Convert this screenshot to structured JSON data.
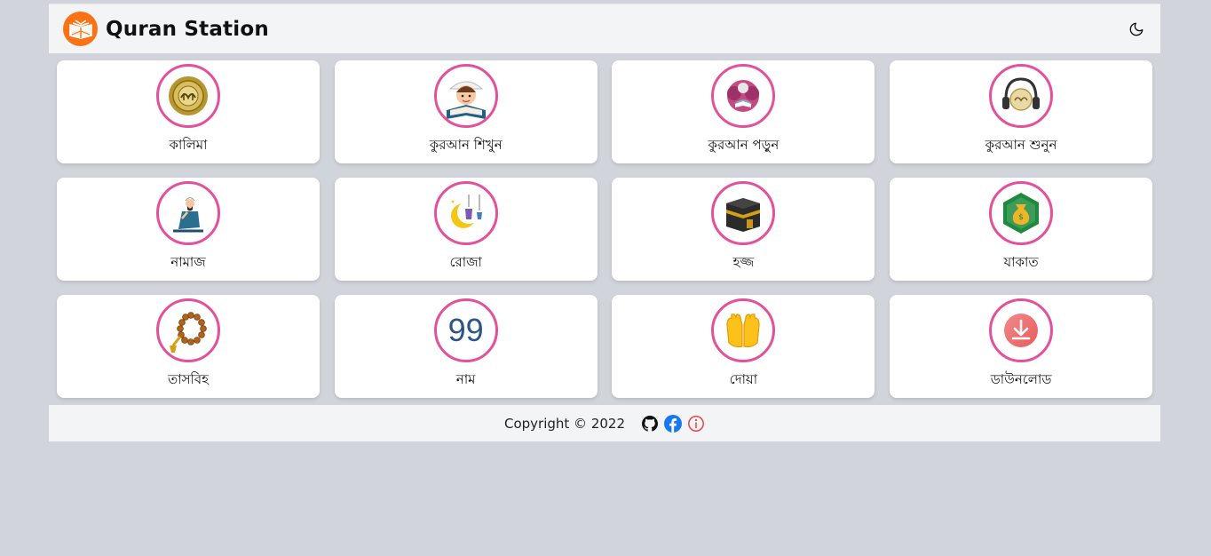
{
  "header": {
    "title": "Quran Station",
    "logo_icon": "open-quran-book-icon",
    "theme_icon": "moon-icon"
  },
  "cards": [
    {
      "label": "কালিমা",
      "icon": "kalima-medallion-icon"
    },
    {
      "label": "কুরআন শিখুন",
      "icon": "child-reading-quran-icon"
    },
    {
      "label": "কুরআন পড়ুন",
      "icon": "person-reading-quran-icon"
    },
    {
      "label": "কুরআন শুনুন",
      "icon": "headphones-quran-icon"
    },
    {
      "label": "নামাজ",
      "icon": "praying-man-icon"
    },
    {
      "label": "রোজা",
      "icon": "crescent-lanterns-icon"
    },
    {
      "label": "হজ্জ",
      "icon": "kaaba-icon"
    },
    {
      "label": "যাকাত",
      "icon": "money-bag-icon"
    },
    {
      "label": "তাসবিহ",
      "icon": "prayer-beads-icon"
    },
    {
      "label": "নাম",
      "icon": "ninety-nine-names-icon",
      "icon_text": "99"
    },
    {
      "label": "দোয়া",
      "icon": "dua-hands-icon"
    },
    {
      "label": "ডাউনলোড",
      "icon": "download-icon"
    }
  ],
  "footer": {
    "copyright": "Copyright © 2022",
    "icons": [
      "github-icon",
      "facebook-icon",
      "info-icon"
    ]
  },
  "colors": {
    "background": "#d1d5db",
    "header_bg": "#f3f4f6",
    "circle_border": "#e2519a",
    "logo_bg": "#f97316",
    "facebook": "#1877f2",
    "info": "#ef4444"
  }
}
